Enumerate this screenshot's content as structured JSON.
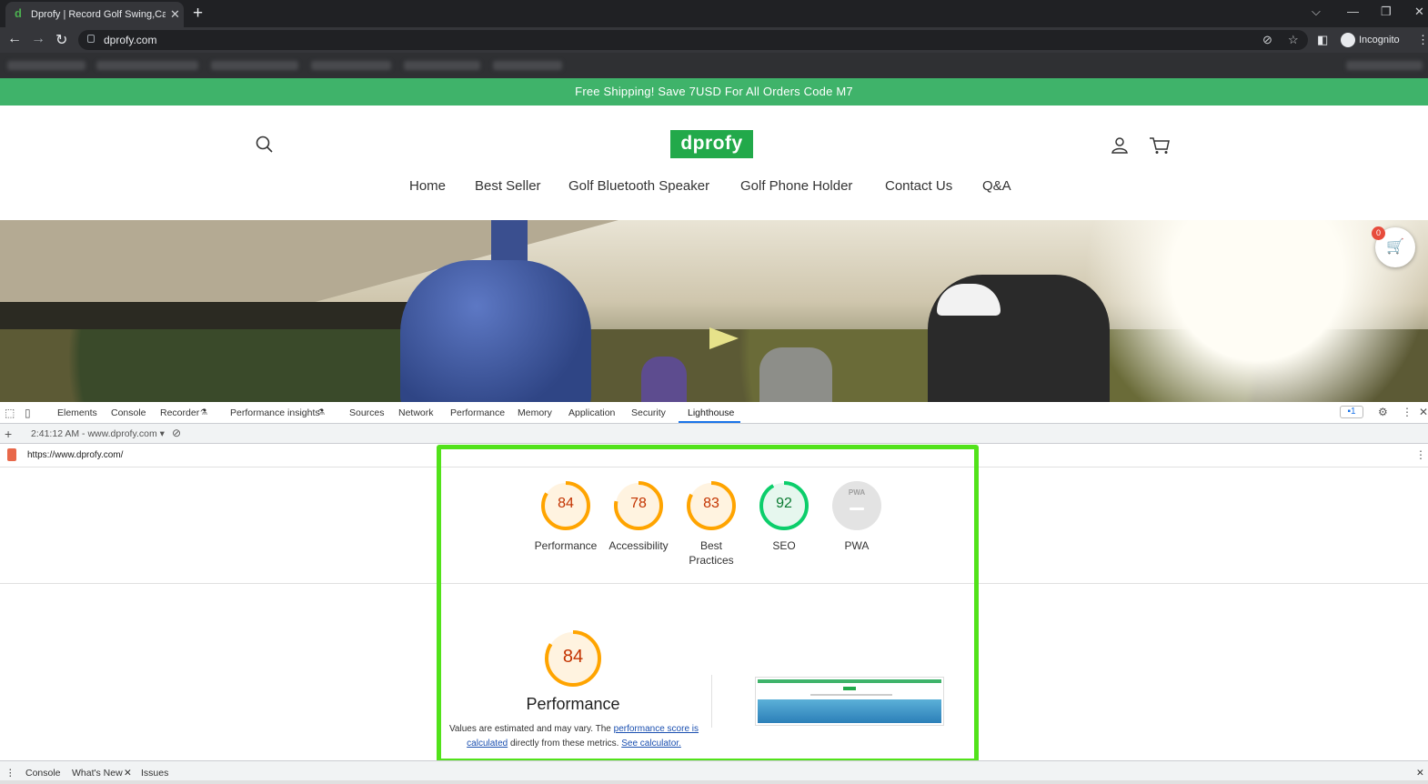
{
  "browser": {
    "tab_title": "Dprofy | Record Golf Swing,Carry",
    "tab_close": "✕",
    "new_tab": "+",
    "url": "dprofy.com",
    "profile_label": "Incognito",
    "icons": [
      "back-icon",
      "forward-icon",
      "reload-icon",
      "lock-icon",
      "eye-off-icon",
      "star-icon",
      "side-panel-icon",
      "incognito-icon",
      "menu-icon"
    ]
  },
  "page": {
    "promo_text": "Free Shipping! Save 7USD For All Orders Code M7",
    "logo_text": "dprofy",
    "nav": [
      "Home",
      "Best Seller",
      "Golf Bluetooth Speaker",
      "Golf Phone Holder",
      "Contact Us",
      "Q&A"
    ],
    "cart_count": "0",
    "brand_green": "#3fb36a"
  },
  "devtools": {
    "tabs": [
      "Elements",
      "Console",
      "Recorder",
      "Performance insights",
      "Sources",
      "Network",
      "Performance",
      "Memory",
      "Application",
      "Security",
      "Lighthouse"
    ],
    "active_tab": "Lighthouse",
    "message_count": "1",
    "report_selector": "2:41:12 AM - www.dprofy.com",
    "report_url": "https://www.dprofy.com/",
    "drawer_tabs": [
      "Console",
      "What's New",
      "Issues"
    ],
    "drawer_active": "What's New"
  },
  "lighthouse": {
    "scores": [
      {
        "label": "Performance",
        "value": 84,
        "color": "#ffa400"
      },
      {
        "label": "Accessibility",
        "value": 78,
        "color": "#ffa400"
      },
      {
        "label": "Best Practices",
        "label_line1": "Best",
        "label_line2": "Practices",
        "value": 83,
        "color": "#ffa400"
      },
      {
        "label": "SEO",
        "value": 92,
        "color": "#0cce6b"
      },
      {
        "label": "PWA",
        "value": null,
        "badge_text": "PWA",
        "color": "#e0e0e0"
      }
    ],
    "performance_detail": {
      "score": 84,
      "title": "Performance",
      "note_prefix": "Values are estimated and may vary. The ",
      "note_link1": "performance score is calculated",
      "note_mid": " directly from these metrics. ",
      "note_link2": "See calculator."
    },
    "highlight_color": "#52e21a"
  }
}
